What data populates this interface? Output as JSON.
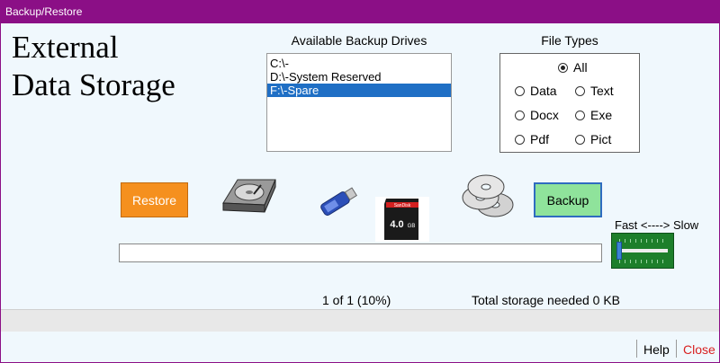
{
  "window": {
    "title": "Backup/Restore"
  },
  "brand": {
    "line1": "External",
    "line2": "Data Storage"
  },
  "drives": {
    "title": "Available Backup Drives",
    "items": [
      "C:\\-",
      "D:\\-System Reserved",
      "F:\\-Spare"
    ],
    "selected": "F:\\-Spare"
  },
  "file_types": {
    "title": "File Types",
    "options": {
      "all": "All",
      "data": "Data",
      "text": "Text",
      "docx": "Docx",
      "exe": "Exe",
      "pdf": "Pdf",
      "pict": "Pict"
    },
    "selected": "All"
  },
  "actions": {
    "restore": "Restore",
    "backup": "Backup"
  },
  "media_icons": [
    "hard-drive-icon",
    "usb-drive-icon",
    "sd-card-icon",
    "cd-discs-icon"
  ],
  "sd_card": {
    "brand": "SanDisk",
    "capacity": "4.0",
    "unit": "GB"
  },
  "speed": {
    "label": "Fast <----> Slow",
    "level": 0.0
  },
  "progress": {
    "fraction": 0.0
  },
  "status": {
    "count": "1 of 1 (10%)",
    "storage": "Total storage needed 0 KB"
  },
  "footer": {
    "help": "Help",
    "close": "Close"
  },
  "colors": {
    "titlebar": "#8b0f86",
    "restore": "#f5901e",
    "backup": "#8fe39b",
    "selected": "#1f6fc5",
    "slider": "#1d7f2b",
    "close": "#d82020"
  }
}
